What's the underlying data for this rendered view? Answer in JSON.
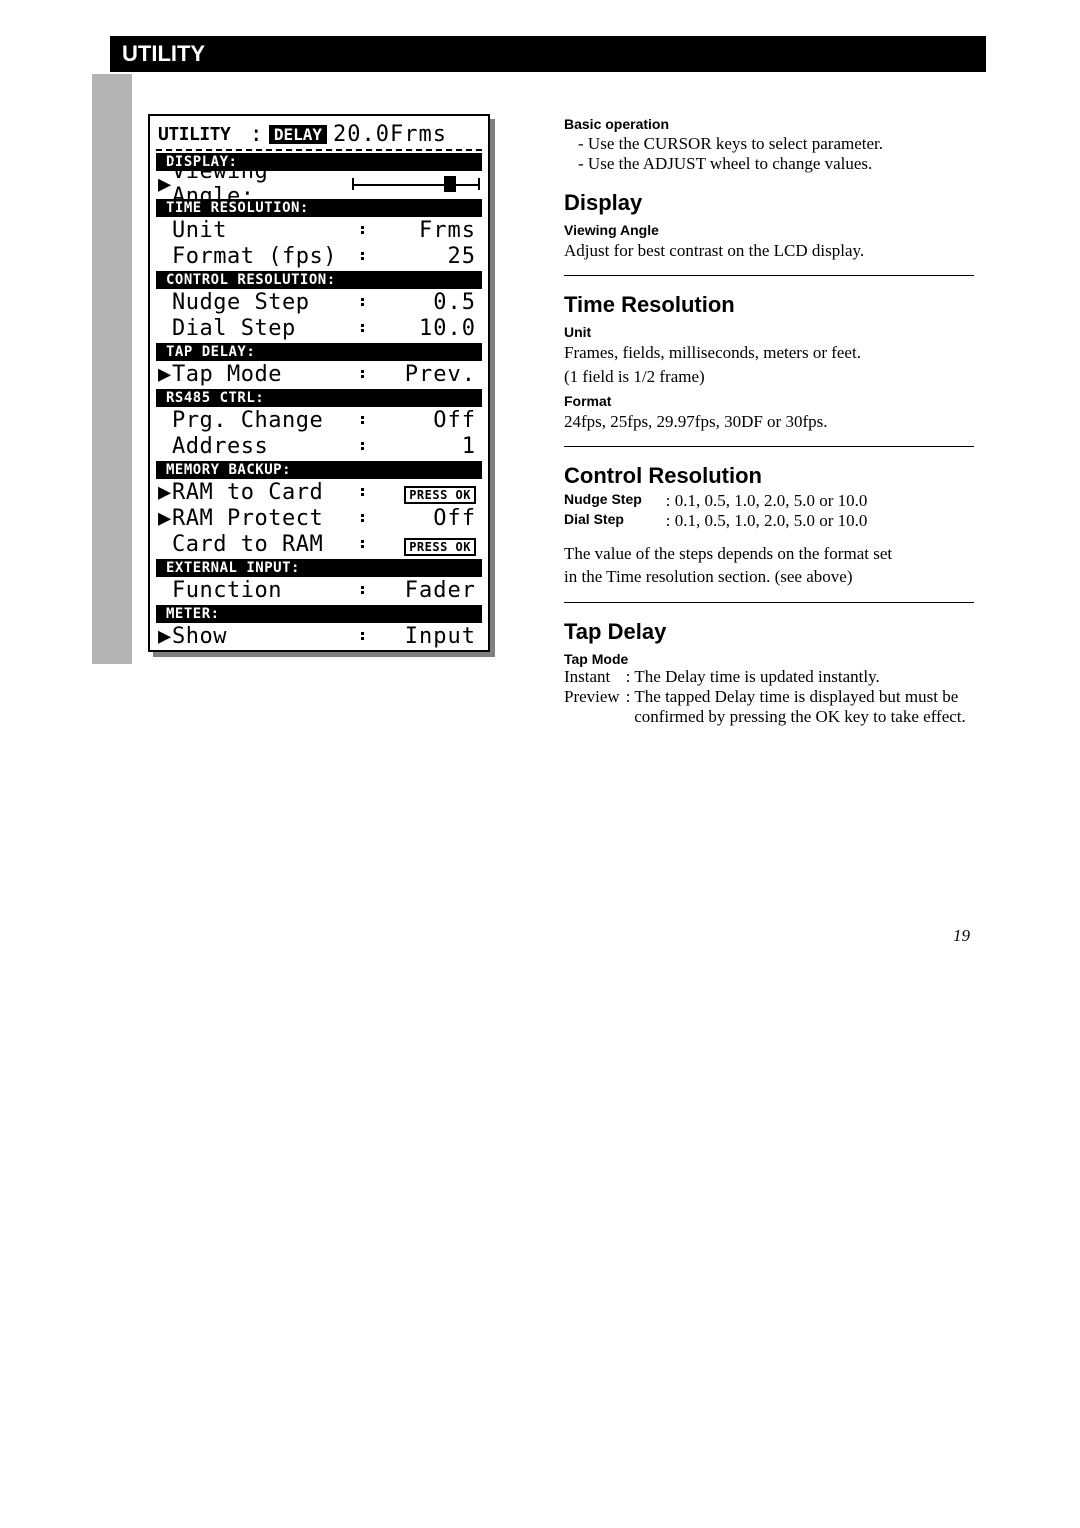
{
  "page": {
    "title": "UTILITY",
    "number": "19"
  },
  "lcd": {
    "title": "UTILITY",
    "badge": "DELAY",
    "delay_value": "20.0Frms",
    "sections": [
      {
        "header": "DISPLAY:",
        "rows": [
          {
            "arrow": true,
            "label": "Viewing Angle:",
            "slider": true,
            "slider_pos": 0.72
          }
        ]
      },
      {
        "header": "TIME RESOLUTION:",
        "rows": [
          {
            "arrow": false,
            "label": "Unit",
            "value": "Frms"
          },
          {
            "arrow": false,
            "label": "Format (fps)",
            "value": "25"
          }
        ]
      },
      {
        "header": "CONTROL RESOLUTION:",
        "rows": [
          {
            "arrow": false,
            "label": "Nudge Step",
            "value": "0.5"
          },
          {
            "arrow": false,
            "label": "Dial Step",
            "value": "10.0"
          }
        ]
      },
      {
        "header": "TAP DELAY:",
        "rows": [
          {
            "arrow": true,
            "label": "Tap Mode",
            "value": "Prev."
          }
        ]
      },
      {
        "header": "RS485 CTRL:",
        "rows": [
          {
            "arrow": false,
            "label": "Prg. Change",
            "value": "Off"
          },
          {
            "arrow": false,
            "label": "Address",
            "value": "1"
          }
        ]
      },
      {
        "header": "MEMORY BACKUP:",
        "rows": [
          {
            "arrow": true,
            "label": "RAM to Card",
            "value": "PRESS OK",
            "pressok": true
          },
          {
            "arrow": true,
            "label": "RAM Protect",
            "value": "Off"
          },
          {
            "arrow": false,
            "label": "Card to RAM",
            "value": "PRESS OK",
            "pressok": true
          }
        ]
      },
      {
        "header": "EXTERNAL INPUT:",
        "rows": [
          {
            "arrow": false,
            "label": "Function",
            "value": "Fader"
          }
        ]
      },
      {
        "header": "METER:",
        "rows": [
          {
            "arrow": true,
            "label": "Show",
            "value": "Input"
          }
        ]
      }
    ]
  },
  "doc": {
    "basic_op": {
      "heading": "Basic operation",
      "items": [
        "Use the CURSOR keys to select parameter.",
        "Use the ADJUST wheel to change values."
      ]
    },
    "display": {
      "heading": "Display",
      "sub": "Viewing Angle",
      "text": "Adjust for best contrast on the LCD display."
    },
    "time_res": {
      "heading": "Time Resolution",
      "unit_sub": "Unit",
      "unit_text1": "Frames, fields, milliseconds, meters or feet.",
      "unit_text2": "(1 field is 1/2 frame)",
      "format_sub": "Format",
      "format_text": "24fps, 25fps, 29.97fps, 30DF or 30fps."
    },
    "ctrl_res": {
      "heading": "Control Resolution",
      "rows": [
        {
          "k": "Nudge Step",
          "v": ": 0.1, 0.5, 1.0, 2.0, 5.0 or 10.0"
        },
        {
          "k": "Dial Step",
          "v": ": 0.1, 0.5, 1.0, 2.0, 5.0 or 10.0"
        }
      ],
      "note1": "The value of the steps depends on the format set",
      "note2": "in the Time resolution section. (see above)"
    },
    "tap_delay": {
      "heading": "Tap Delay",
      "sub": "Tap Mode",
      "rows": [
        {
          "k": "Instant",
          "v": ": The Delay time is updated instantly."
        },
        {
          "k": "Preview",
          "v": ": The tapped Delay time is displayed but must be"
        },
        {
          "k": "",
          "v": "  confirmed by pressing the OK key to take effect."
        }
      ]
    }
  }
}
